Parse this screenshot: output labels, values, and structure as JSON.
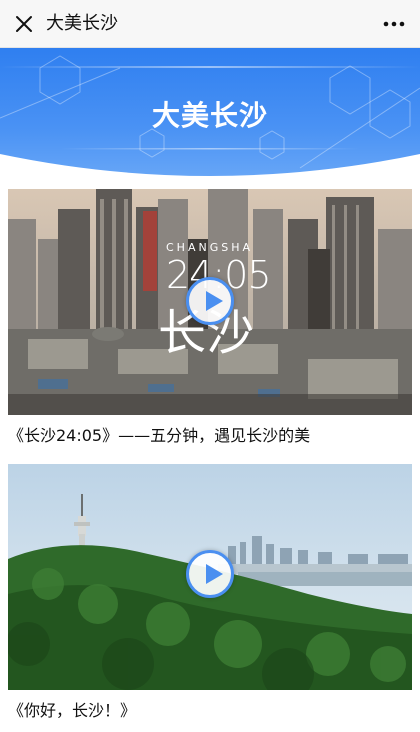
{
  "topbar": {
    "title": "大美长沙",
    "close_icon": "close-icon",
    "more_icon": "more-dots-icon"
  },
  "banner": {
    "title": "大美长沙",
    "color": "#2f7ff0"
  },
  "videos": [
    {
      "overlay_top": "CHANGSHA",
      "overlay_time": "24:05",
      "overlay_name": "长沙",
      "caption": "《长沙24:05》——五分钟，遇见长沙的美"
    },
    {
      "caption": "《你好，长沙！》"
    }
  ],
  "play_icon": "play-icon",
  "accent": "#4a8ff0"
}
